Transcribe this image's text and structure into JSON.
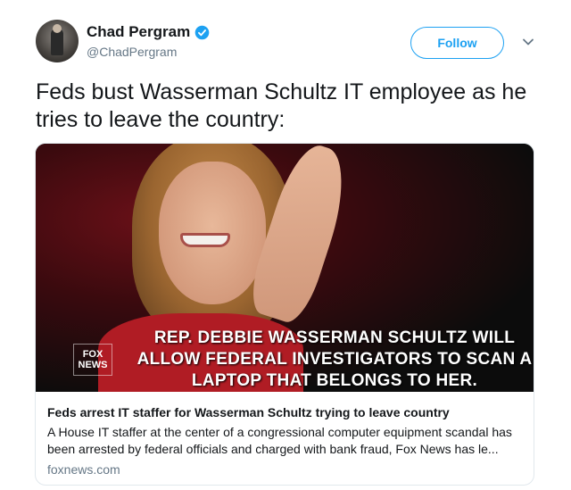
{
  "author": {
    "display_name": "Chad Pergram",
    "handle": "@ChadPergram",
    "avatar_icon": "profile-photo",
    "verified_icon": "verified-badge-icon"
  },
  "actions": {
    "follow_label": "Follow",
    "more_icon": "chevron-down-icon"
  },
  "tweet": {
    "text": "Feds bust Wasserman Schultz IT employee as he tries to leave the country:"
  },
  "card": {
    "media": {
      "caption": "REP. DEBBIE WASSERMAN SCHULTZ WILL ALLOW FEDERAL INVESTIGATORS TO SCAN A LAPTOP THAT BELONGS TO HER.",
      "logo_text": "FOX NEWS"
    },
    "title": "Feds arrest IT staffer for Wasserman Schultz trying to leave country",
    "description": "A House IT staffer at the center of a congressional computer equipment scandal has been arrested by federal officials and charged with bank fraud, Fox News has le...",
    "domain": "foxnews.com"
  },
  "colors": {
    "accent": "#1da1f2",
    "text_primary": "#14171a",
    "text_secondary": "#657786",
    "border": "#e1e8ed"
  }
}
